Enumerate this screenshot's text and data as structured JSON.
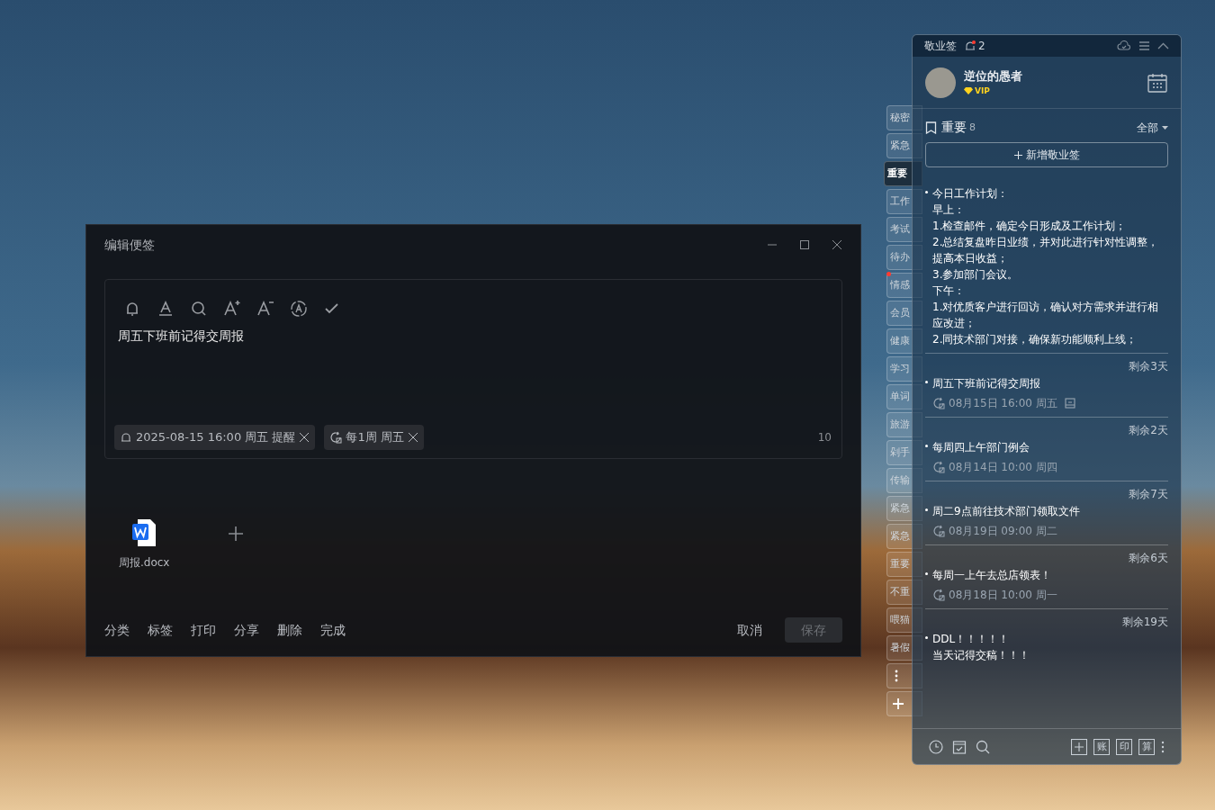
{
  "editor": {
    "title": "编辑便签",
    "content": "周五下班前记得交周报",
    "chips": [
      {
        "kind": "reminder",
        "label": "2025-08-15 16:00 周五 提醒"
      },
      {
        "kind": "repeat",
        "label": "每1周 周五"
      }
    ],
    "char_count": "10",
    "attachments": [
      {
        "name": "周报.docx"
      }
    ],
    "actions": [
      "分类",
      "标签",
      "打印",
      "分享",
      "删除",
      "完成"
    ],
    "cancel": "取消",
    "save": {
      "label": "保存",
      "disabled": true
    }
  },
  "side_tabs": [
    {
      "label": "秘密",
      "selected": false,
      "dot": false
    },
    {
      "label": "紧急",
      "selected": false,
      "dot": false
    },
    {
      "label": "重要",
      "selected": true,
      "dot": false
    },
    {
      "label": "工作",
      "selected": false,
      "dot": false
    },
    {
      "label": "考试",
      "selected": false,
      "dot": false
    },
    {
      "label": "待办",
      "selected": false,
      "dot": false
    },
    {
      "label": "情感",
      "selected": false,
      "dot": true
    },
    {
      "label": "会员",
      "selected": false,
      "dot": false
    },
    {
      "label": "健康",
      "selected": false,
      "dot": false
    },
    {
      "label": "学习",
      "selected": false,
      "dot": false
    },
    {
      "label": "单词",
      "selected": false,
      "dot": false
    },
    {
      "label": "旅游",
      "selected": false,
      "dot": false
    },
    {
      "label": "剁手",
      "selected": false,
      "dot": false
    },
    {
      "label": "传输",
      "selected": false,
      "dot": false
    },
    {
      "label": "紧急",
      "selected": false,
      "dot": false
    },
    {
      "label": "紧急",
      "selected": false,
      "dot": false
    },
    {
      "label": "重要",
      "selected": false,
      "dot": false
    },
    {
      "label": "不重",
      "selected": false,
      "dot": false
    },
    {
      "label": "喂猫",
      "selected": false,
      "dot": false
    },
    {
      "label": "暑假",
      "selected": false,
      "dot": false
    }
  ],
  "widget": {
    "app_name": "敬业签",
    "notification_count": "2",
    "user": {
      "name": "逆位的愚者",
      "badge": "VIP"
    },
    "category": {
      "name": "重要",
      "count": "8"
    },
    "filter": "全部",
    "add_button": "新增敬业签",
    "notes": [
      {
        "lines": [
          "今日工作计划：",
          "早上：",
          "1.检查邮件，确定今日形成及工作计划；",
          "2.总结复盘昨日业绩，并对此进行针对性调整，提高本日收益；",
          "3.参加部门会议。",
          "下午：",
          "1.对优质客户进行回访，确认对方需求并进行相应改进；",
          "2.同技术部门对接，确保新功能顺利上线；"
        ]
      },
      {
        "remaining": "剩余3天",
        "lines": [
          "周五下班前记得交周报"
        ],
        "time": "08月15日 16:00 周五",
        "attachment": true
      },
      {
        "remaining": "剩余2天",
        "lines": [
          "每周四上午部门例会"
        ],
        "time": "08月14日 10:00 周四",
        "attachment": false
      },
      {
        "remaining": "剩余7天",
        "lines": [
          "周二9点前往技术部门领取文件"
        ],
        "time": "08月19日 09:00 周二",
        "attachment": false
      },
      {
        "remaining": "剩余6天",
        "lines": [
          "每周一上午去总店领表！"
        ],
        "time": "08月18日 10:00 周一",
        "attachment": false
      },
      {
        "remaining": "剩余19天",
        "lines": [
          "DDL！！！！！",
          "当天记得交稿！！！"
        ]
      }
    ],
    "footer_buttons": [
      "账",
      "印",
      "算"
    ]
  }
}
